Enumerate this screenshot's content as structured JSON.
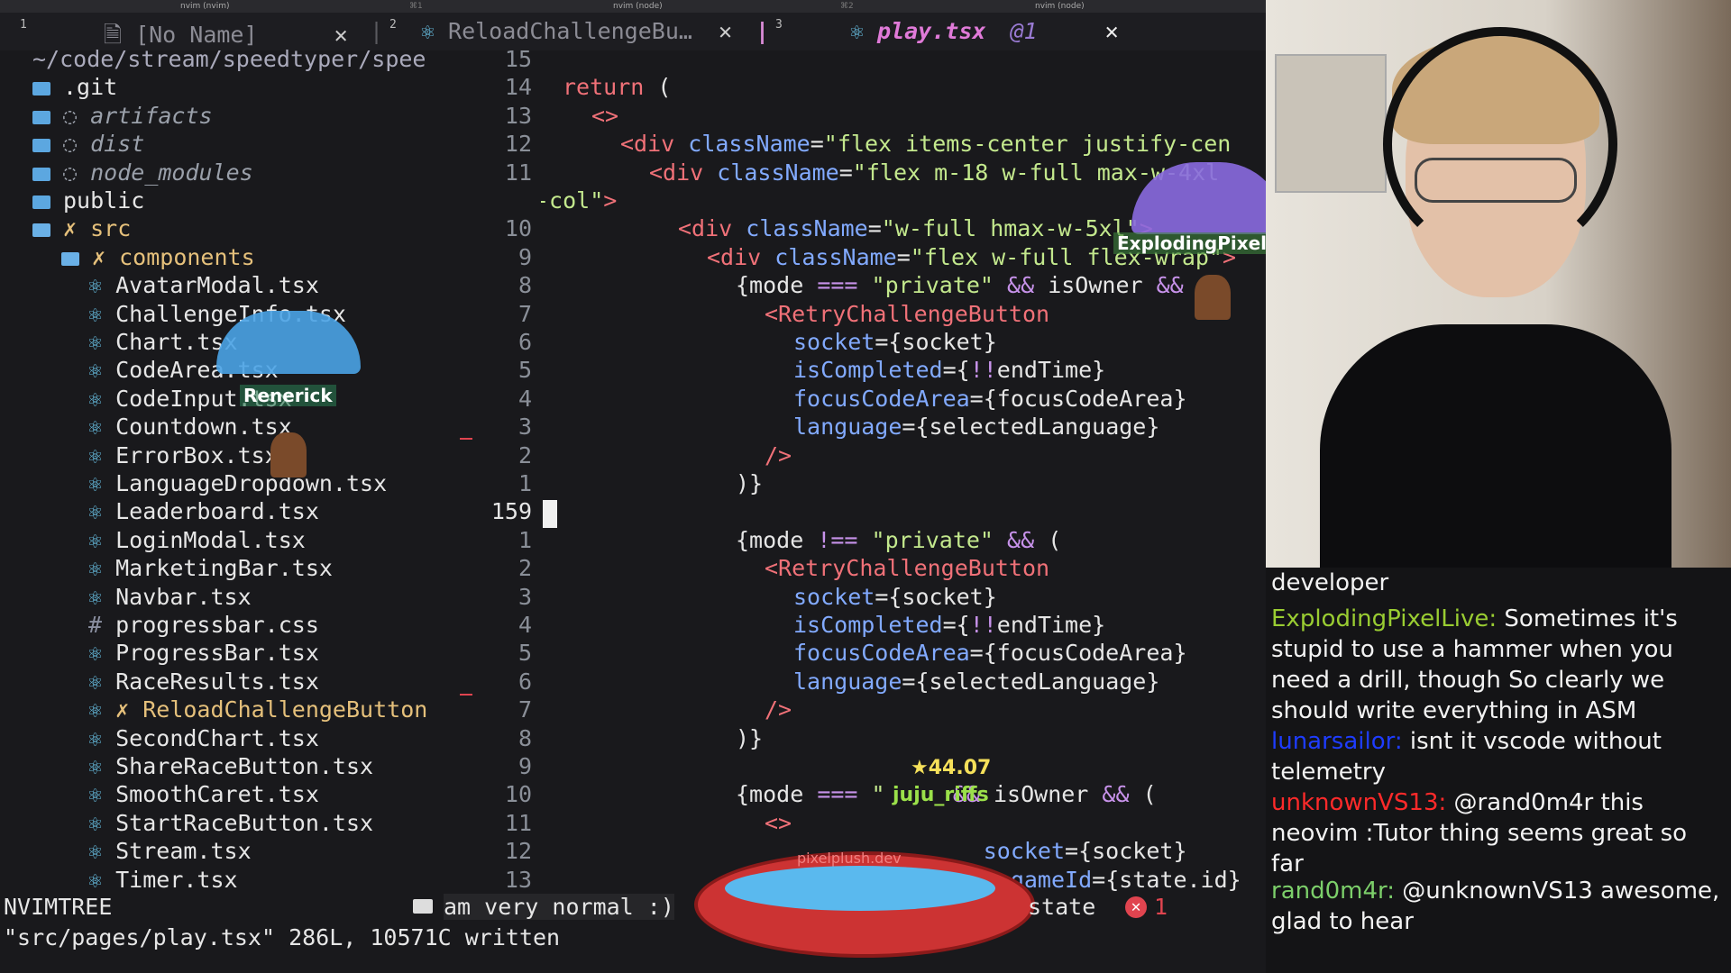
{
  "topbar": {
    "left": "nvim (nvim)",
    "left_tag": "⌘1",
    "middle": "nvim (node)",
    "middle_tag": "⌘2",
    "right": "nvim (node)"
  },
  "tabs": [
    {
      "num": "1",
      "label": "[No Name]"
    },
    {
      "num": "2",
      "label": "ReloadChallengeBu…"
    },
    {
      "num": "3",
      "label": "play.tsx",
      "badge": "@1"
    }
  ],
  "tree": {
    "root_path": "~/code/stream/speedtyper/spee",
    "items": [
      {
        "label": ".git",
        "kind": "folder"
      },
      {
        "label": "artifacts",
        "kind": "ignored"
      },
      {
        "label": "dist",
        "kind": "ignored"
      },
      {
        "label": "node_modules",
        "kind": "ignored"
      },
      {
        "label": "public",
        "kind": "folder"
      },
      {
        "label": "src",
        "kind": "open-folder",
        "marker": "✗"
      },
      {
        "label": "components",
        "kind": "open-folder",
        "marker": "✗"
      },
      {
        "label": "AvatarModal.tsx",
        "kind": "file"
      },
      {
        "label": "ChallengeInfo.tsx",
        "kind": "file"
      },
      {
        "label": "Chart.tsx",
        "kind": "file"
      },
      {
        "label": "CodeArea.tsx",
        "kind": "file"
      },
      {
        "label": "CodeInput.tsx",
        "kind": "file"
      },
      {
        "label": "Countdown.tsx",
        "kind": "file"
      },
      {
        "label": "ErrorBox.tsx",
        "kind": "file"
      },
      {
        "label": "LanguageDropdown.tsx",
        "kind": "file"
      },
      {
        "label": "Leaderboard.tsx",
        "kind": "file"
      },
      {
        "label": "LoginModal.tsx",
        "kind": "file"
      },
      {
        "label": "MarketingBar.tsx",
        "kind": "file"
      },
      {
        "label": "Navbar.tsx",
        "kind": "file"
      },
      {
        "label": "progressbar.css",
        "kind": "css"
      },
      {
        "label": "ProgressBar.tsx",
        "kind": "file"
      },
      {
        "label": "RaceResults.tsx",
        "kind": "file"
      },
      {
        "label": "ReloadChallengeButton",
        "kind": "modified",
        "marker": "✗"
      },
      {
        "label": "SecondChart.tsx",
        "kind": "file"
      },
      {
        "label": "ShareRaceButton.tsx",
        "kind": "file"
      },
      {
        "label": "SmoothCaret.tsx",
        "kind": "file"
      },
      {
        "label": "StartRaceButton.tsx",
        "kind": "file"
      },
      {
        "label": "Stream.tsx",
        "kind": "file"
      },
      {
        "label": "Timer.tsx",
        "kind": "file"
      }
    ]
  },
  "gutter": [
    "15",
    "14",
    "13",
    "12",
    "11",
    "",
    "10",
    "9",
    "8",
    "7",
    "6",
    "5",
    "4",
    "3",
    "2",
    "1",
    "159",
    "1",
    "2",
    "3",
    "4",
    "5",
    "6",
    "7",
    "8",
    "9",
    "10",
    "11",
    "12",
    "13"
  ],
  "code": [
    {
      "indent": 1,
      "parts": [
        [
          "kw",
          "return"
        ],
        [
          "br",
          " ("
        ]
      ]
    },
    {
      "indent": 2,
      "parts": [
        [
          "tag",
          "<>"
        ]
      ]
    },
    {
      "indent": 3,
      "parts": [
        [
          "tag",
          "<div "
        ],
        [
          "attr",
          "className"
        ],
        [
          "br",
          "="
        ],
        [
          "str",
          "\"flex items-center justify-cen"
        ]
      ]
    },
    {
      "indent": 4,
      "parts": [
        [
          "tag",
          "<div "
        ],
        [
          "attr",
          "className"
        ],
        [
          "br",
          "="
        ],
        [
          "str",
          "\"flex m-18 w-full max-w-4xl"
        ]
      ]
    },
    {
      "indent": 0,
      "parts": [
        [
          "str",
          "-col\""
        ],
        [
          "tag",
          ">"
        ]
      ]
    },
    {
      "indent": 5,
      "parts": [
        [
          "tag",
          "<div "
        ],
        [
          "attr",
          "className"
        ],
        [
          "br",
          "="
        ],
        [
          "str",
          "\"w-full hmax-w-5xl\""
        ],
        [
          "tag",
          ">"
        ]
      ]
    },
    {
      "indent": 6,
      "parts": [
        [
          "tag",
          "<div "
        ],
        [
          "attr",
          "className"
        ],
        [
          "br",
          "="
        ],
        [
          "str",
          "\"flex w-full flex-wrap\""
        ],
        [
          "tag",
          ">"
        ]
      ]
    },
    {
      "indent": 7,
      "parts": [
        [
          "br",
          "{mode "
        ],
        [
          "op",
          "==="
        ],
        [
          "str",
          " \"private\" "
        ],
        [
          "op",
          "&&"
        ],
        [
          "br",
          " isOwner "
        ],
        [
          "op",
          "&&"
        ],
        [
          "br",
          " ("
        ]
      ]
    },
    {
      "indent": 8,
      "parts": [
        [
          "tag",
          "<RetryChallengeButton"
        ]
      ]
    },
    {
      "indent": 9,
      "parts": [
        [
          "attr",
          "socket"
        ],
        [
          "br",
          "={socket}"
        ]
      ]
    },
    {
      "indent": 9,
      "parts": [
        [
          "attr",
          "isCompleted"
        ],
        [
          "br",
          "={"
        ],
        [
          "op",
          "!!"
        ],
        [
          "br",
          "endTime}"
        ]
      ]
    },
    {
      "indent": 9,
      "parts": [
        [
          "attr",
          "focusCodeArea"
        ],
        [
          "br",
          "={focusCodeArea}"
        ]
      ]
    },
    {
      "indent": 9,
      "parts": [
        [
          "attr",
          "language"
        ],
        [
          "br",
          "={selectedLanguage}"
        ]
      ]
    },
    {
      "indent": 8,
      "parts": [
        [
          "tag",
          "/>"
        ]
      ]
    },
    {
      "indent": 7,
      "parts": [
        [
          "br",
          ")}"
        ]
      ]
    },
    {
      "indent": 0,
      "parts": [
        [
          "br",
          ""
        ]
      ]
    },
    {
      "indent": 7,
      "parts": [
        [
          "br",
          "{mode "
        ],
        [
          "op",
          "!=="
        ],
        [
          "str",
          " \"private\" "
        ],
        [
          "op",
          "&&"
        ],
        [
          "br",
          " ("
        ]
      ]
    },
    {
      "indent": 8,
      "parts": [
        [
          "tag",
          "<RetryChallengeButton"
        ]
      ]
    },
    {
      "indent": 9,
      "parts": [
        [
          "attr",
          "socket"
        ],
        [
          "br",
          "={socket}"
        ]
      ]
    },
    {
      "indent": 9,
      "parts": [
        [
          "attr",
          "isCompleted"
        ],
        [
          "br",
          "={"
        ],
        [
          "op",
          "!!"
        ],
        [
          "br",
          "endTime}"
        ]
      ]
    },
    {
      "indent": 9,
      "parts": [
        [
          "attr",
          "focusCodeArea"
        ],
        [
          "br",
          "={focusCodeArea}"
        ]
      ]
    },
    {
      "indent": 9,
      "parts": [
        [
          "attr",
          "language"
        ],
        [
          "br",
          "={selectedLanguage}"
        ]
      ]
    },
    {
      "indent": 8,
      "parts": [
        [
          "tag",
          "/>"
        ]
      ]
    },
    {
      "indent": 7,
      "parts": [
        [
          "br",
          ")}"
        ]
      ]
    },
    {
      "indent": 0,
      "parts": [
        [
          "br",
          ""
        ]
      ]
    },
    {
      "indent": 7,
      "parts": [
        [
          "br",
          "{mode "
        ],
        [
          "op",
          "==="
        ],
        [
          "str",
          " \""
        ],
        [
          "br",
          "     "
        ],
        [
          "op",
          "&&"
        ],
        [
          "br",
          " isOwner "
        ],
        [
          "op",
          "&&"
        ],
        [
          "br",
          " ("
        ]
      ]
    },
    {
      "indent": 8,
      "parts": [
        [
          "tag",
          "<>"
        ]
      ]
    },
    {
      "indent": 9,
      "parts": [
        [
          "br",
          "              "
        ],
        [
          "attr",
          "socket"
        ],
        [
          "br",
          "={socket}"
        ]
      ]
    },
    {
      "indent": 9,
      "parts": [
        [
          "br",
          "                "
        ],
        [
          "attr",
          "gameId"
        ],
        [
          "br",
          "={state.id}"
        ]
      ]
    }
  ],
  "status": {
    "mode": "NVIMTREE",
    "message": "am very normal :)",
    "tail": "state",
    "error_count": "1"
  },
  "cmdline": "\"src/pages/play.tsx\" 286L, 10571C written",
  "overlays": {
    "parachute_user_1": "Renerick",
    "parachute_user_2": "ExplodingPixelLive",
    "score": "44.07",
    "score_user": "juju_riffs",
    "pool_label": "pixelplush.dev"
  },
  "chat": [
    {
      "user": "",
      "text": "developer",
      "color": "#f2f2f2"
    },
    {
      "user": "ExplodingPixelLive:",
      "text": " Sometimes it's stupid to use a hammer when you need a drill, though So clearly we should write everything in ASM",
      "color": "#9acd32"
    },
    {
      "user": "lunarsailor:",
      "text": " isnt it vscode without telemetry",
      "color": "#1e3cff"
    },
    {
      "user": "unknownVS13:",
      "text": " @rand0m4r this neovim :Tutor thing seems great so far",
      "color": "#ff2a2a"
    },
    {
      "user": "rand0m4r:",
      "text": " @unknownVS13 awesome, glad to hear",
      "color": "#7ccf6a"
    }
  ],
  "colors": {
    "folder": "#5ca7e0",
    "react_icon": "#6ac4e8",
    "modified": "#e5c07b",
    "error": "#e0444f"
  }
}
